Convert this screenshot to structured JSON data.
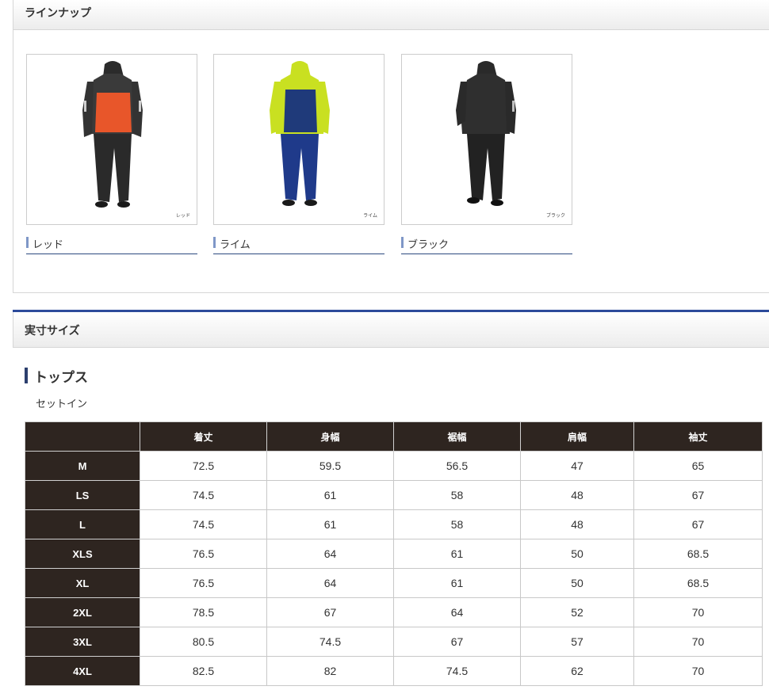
{
  "lineup": {
    "title": "ラインナップ",
    "products": [
      {
        "name": "レッド",
        "tag": "レッド",
        "accent": "#e8562a"
      },
      {
        "name": "ライム",
        "tag": "ライム",
        "accent": "#c9e021"
      },
      {
        "name": "ブラック",
        "tag": "ブラック",
        "accent": "#2a2a2a"
      }
    ]
  },
  "size_section": {
    "title": "実寸サイズ",
    "subtitle": "トップス",
    "note": "セットイン"
  },
  "size_table": {
    "columns": [
      "",
      "着丈",
      "身幅",
      "裾幅",
      "肩幅",
      "袖丈"
    ],
    "rows": [
      {
        "size": "M",
        "values": [
          "72.5",
          "59.5",
          "56.5",
          "47",
          "65"
        ]
      },
      {
        "size": "LS",
        "values": [
          "74.5",
          "61",
          "58",
          "48",
          "67"
        ]
      },
      {
        "size": "L",
        "values": [
          "74.5",
          "61",
          "58",
          "48",
          "67"
        ]
      },
      {
        "size": "XLS",
        "values": [
          "76.5",
          "64",
          "61",
          "50",
          "68.5"
        ]
      },
      {
        "size": "XL",
        "values": [
          "76.5",
          "64",
          "61",
          "50",
          "68.5"
        ]
      },
      {
        "size": "2XL",
        "values": [
          "78.5",
          "67",
          "64",
          "52",
          "70"
        ]
      },
      {
        "size": "3XL",
        "values": [
          "80.5",
          "74.5",
          "67",
          "57",
          "70"
        ]
      },
      {
        "size": "4XL",
        "values": [
          "82.5",
          "82",
          "74.5",
          "62",
          "70"
        ]
      }
    ]
  },
  "colors": {
    "header_bg": "#2e2520",
    "accent_blue": "#2c4a9a"
  }
}
